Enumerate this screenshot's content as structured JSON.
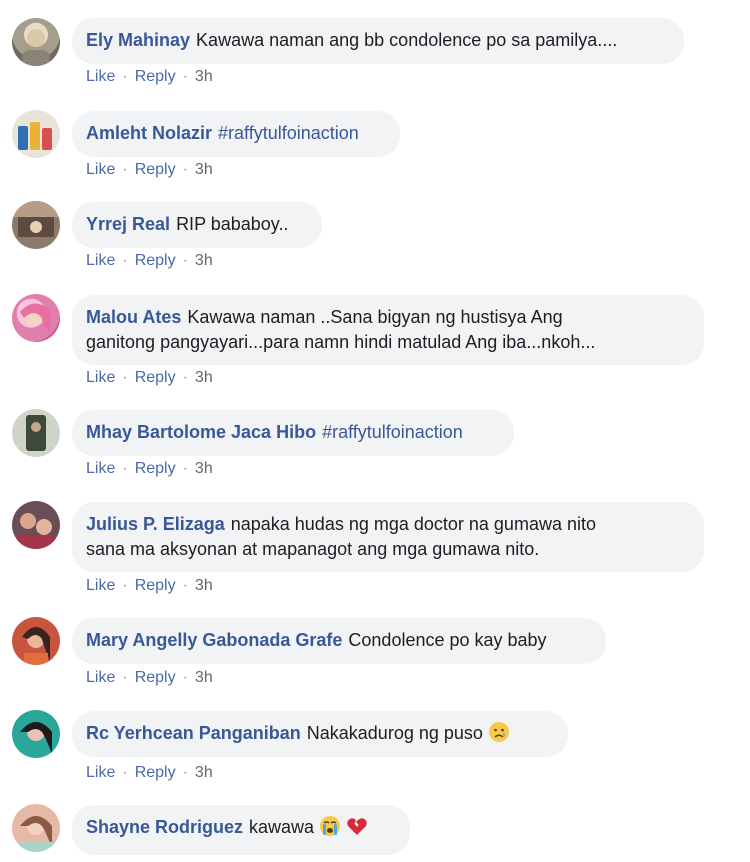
{
  "comments": [
    {
      "author": "Ely Mahinay",
      "text": "Kawawa naman ang bb condolence po sa pamilya....",
      "like": "Like",
      "reply": "Reply",
      "time": "3h"
    },
    {
      "author": "Amleht Nolazir",
      "hashtag": "#raffytulfoinaction",
      "like": "Like",
      "reply": "Reply",
      "time": "3h"
    },
    {
      "author": "Yrrej Real",
      "text": "RIP bababoy..",
      "like": "Like",
      "reply": "Reply",
      "time": "3h"
    },
    {
      "author": "Malou Ates",
      "text_line1": "Kawawa naman ..Sana bigyan ng hustisya Ang",
      "text_line2": "ganitong pangyayari...para namn hindi matulad Ang iba...nkoh...",
      "like": "Like",
      "reply": "Reply",
      "time": "3h"
    },
    {
      "author": "Mhay Bartolome Jaca Hibo",
      "hashtag": "#raffytulfoinaction",
      "like": "Like",
      "reply": "Reply",
      "time": "3h"
    },
    {
      "author": "Julius P. Elizaga",
      "text_line1": "napaka hudas ng mga doctor na gumawa nito",
      "text_line2": "sana ma aksyonan at mapanagot ang mga gumawa nito.",
      "like": "Like",
      "reply": "Reply",
      "time": "3h"
    },
    {
      "author": "Mary Angelly Gabonada Grafe",
      "text": "Condolence po kay baby",
      "like": "Like",
      "reply": "Reply",
      "time": "3h"
    },
    {
      "author": "Rc Yerhcean Panganiban",
      "text": "Nakakadurog ng puso",
      "emoji": "sad-face-emoji",
      "like": "Like",
      "reply": "Reply",
      "time": "3h"
    },
    {
      "author": "Shayne Rodriguez",
      "text": "kawawa",
      "emoji": "crying-face-emoji",
      "emoji2": "broken-heart-emoji"
    }
  ],
  "colors": {
    "author": "#385898",
    "bubble": "#f2f3f5",
    "action": "#4b6aa8",
    "meta": "#606770"
  }
}
